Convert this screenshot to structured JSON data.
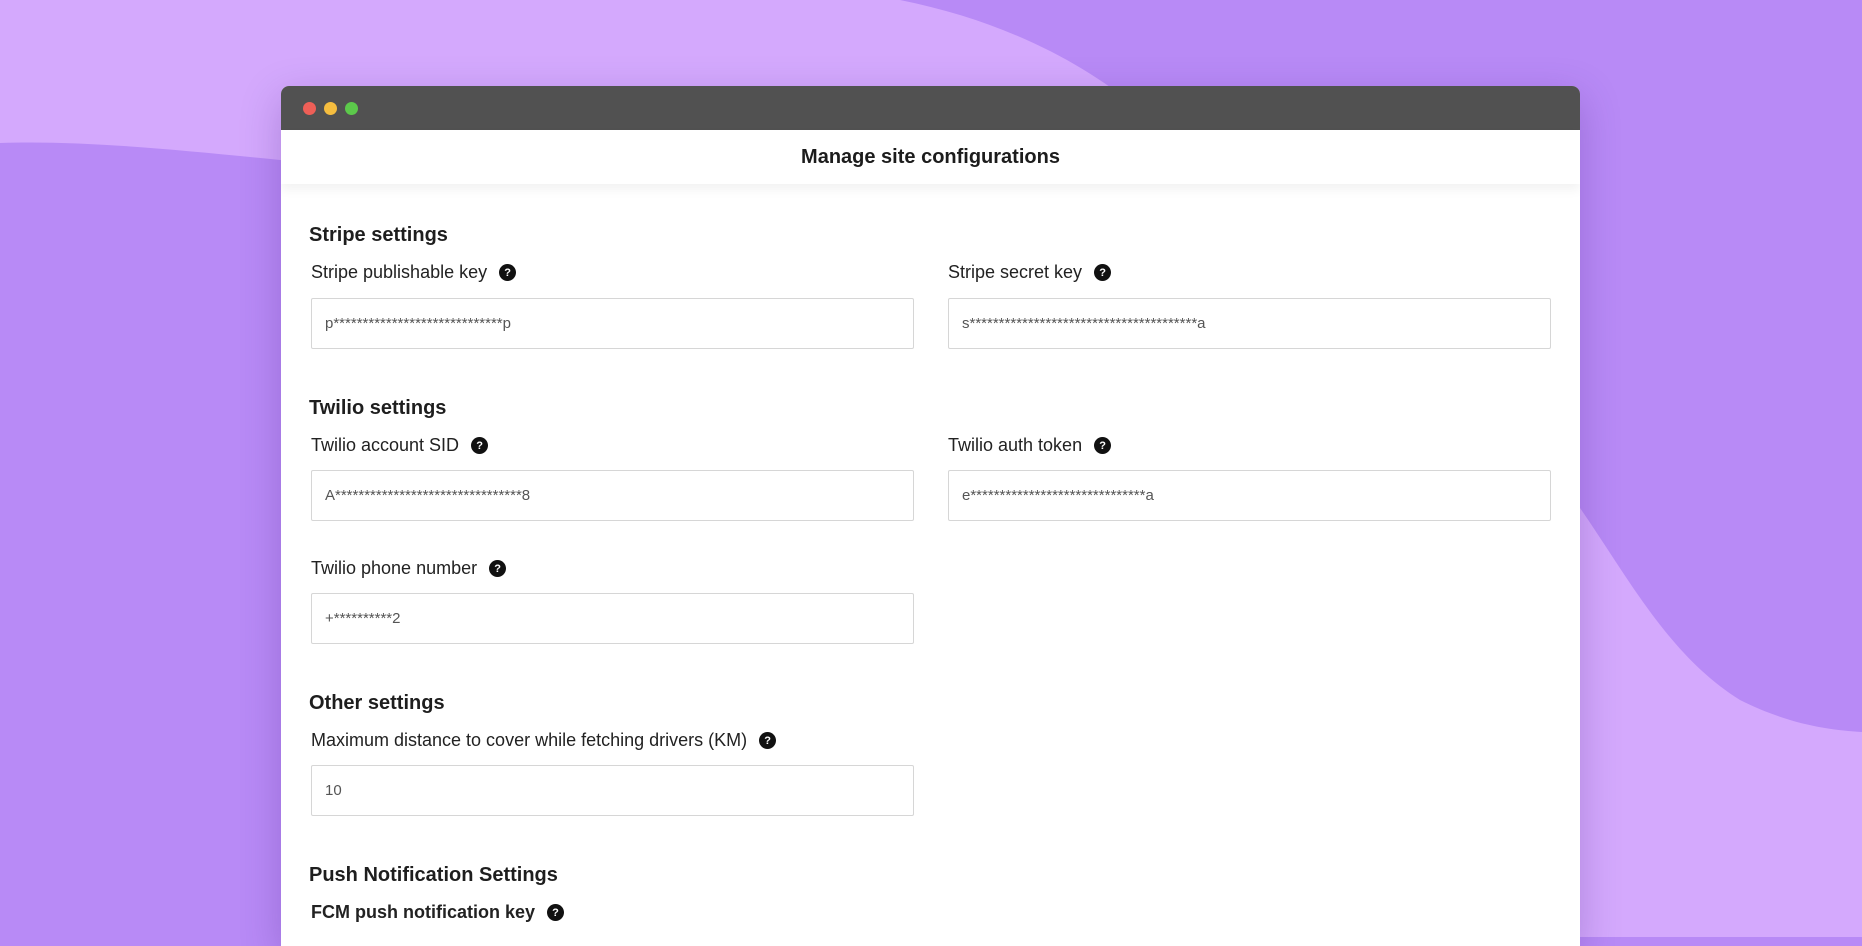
{
  "window": {
    "title": "Manage site configurations"
  },
  "sections": {
    "stripe": {
      "title": "Stripe settings",
      "publishable_key": {
        "label": "Stripe publishable key",
        "value": "p*****************************p"
      },
      "secret_key": {
        "label": "Stripe secret key",
        "value": "s***************************************a"
      }
    },
    "twilio": {
      "title": "Twilio settings",
      "account_sid": {
        "label": "Twilio account SID",
        "value": "A********************************8"
      },
      "auth_token": {
        "label": "Twilio auth token",
        "value": "e******************************a"
      },
      "phone_number": {
        "label": "Twilio phone number",
        "value": "+**********2"
      }
    },
    "other": {
      "title": "Other settings",
      "max_distance": {
        "label": "Maximum distance to cover while fetching drivers (KM)",
        "value": "10"
      }
    },
    "push": {
      "title": "Push Notification Settings",
      "fcm_key": {
        "label": "FCM push notification key"
      }
    }
  },
  "help_glyph": "?",
  "icons": {
    "help": "question-circle-icon"
  },
  "colors": {
    "background": "#b88af6",
    "background_light": "#d4a9fd",
    "titlebar": "#515151",
    "help_icon": "#111111"
  }
}
